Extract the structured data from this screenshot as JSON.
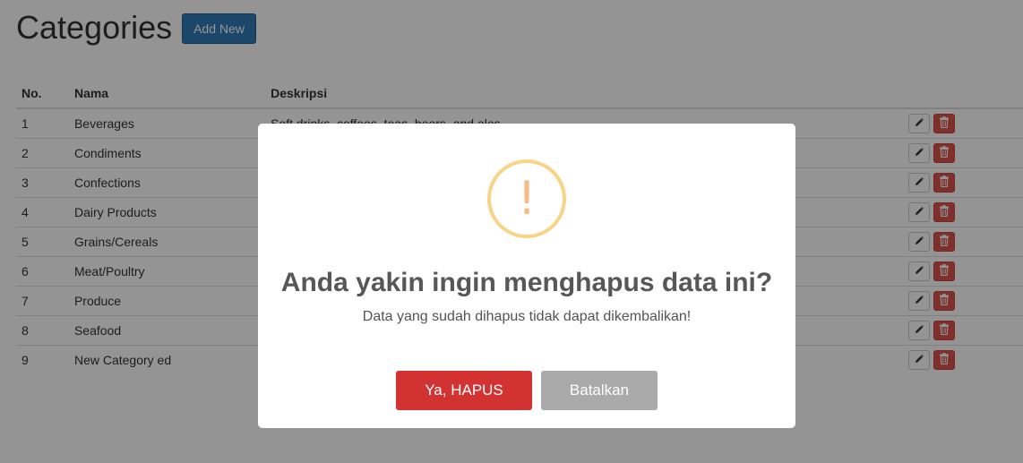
{
  "header": {
    "title": "Categories",
    "add_button": "Add New"
  },
  "table": {
    "columns": [
      "No.",
      "Nama",
      "Deskripsi"
    ],
    "rows": [
      {
        "no": "1",
        "nama": "Beverages",
        "deskripsi": "Soft drinks, coffees, teas, beers, and ales"
      },
      {
        "no": "2",
        "nama": "Condiments",
        "deskripsi": ""
      },
      {
        "no": "3",
        "nama": "Confections",
        "deskripsi": ""
      },
      {
        "no": "4",
        "nama": "Dairy Products",
        "deskripsi": ""
      },
      {
        "no": "5",
        "nama": "Grains/Cereals",
        "deskripsi": ""
      },
      {
        "no": "6",
        "nama": "Meat/Poultry",
        "deskripsi": ""
      },
      {
        "no": "7",
        "nama": "Produce",
        "deskripsi": ""
      },
      {
        "no": "8",
        "nama": "Seafood",
        "deskripsi": ""
      },
      {
        "no": "9",
        "nama": "New Category ed",
        "deskripsi": ""
      }
    ],
    "action_icons": {
      "edit": "pencil-icon",
      "delete": "trash-icon"
    }
  },
  "dialog": {
    "icon": "warning-icon",
    "icon_glyph": "!",
    "title": "Anda yakin ingin menghapus data ini?",
    "text": "Data yang sudah dihapus tidak dapat dikembalikan!",
    "confirm_label": "Ya, HAPUS",
    "cancel_label": "Batalkan"
  },
  "colors": {
    "primary": "#337ab7",
    "danger": "#d9534f",
    "confirm": "#d33232",
    "cancel": "#aaaaaa",
    "warning": "#f8bb86"
  }
}
